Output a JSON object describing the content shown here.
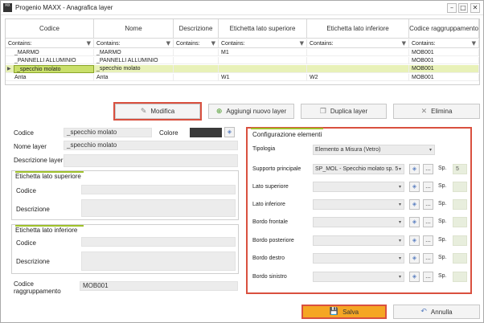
{
  "window": {
    "app_icon": "MX",
    "title": "Progenio MAXX - Anagrafica layer",
    "minimize_glyph": "–",
    "maximize_glyph": "□",
    "close_glyph": "✕"
  },
  "grid": {
    "columns": [
      "Codice",
      "Nome",
      "Descrizione",
      "Etichetta lato superiore",
      "Etichetta lato inferiore",
      "Codice raggruppamento"
    ],
    "filter_label": "Contains:",
    "filter_icon": "▼",
    "row_indicator": "▶",
    "rows": [
      [
        "_MARMO",
        "_MARMO",
        "",
        "M1",
        "",
        "MOB001"
      ],
      [
        "_PANNELLI ALLUMINIO",
        "_PANNELLI ALLUMINIO",
        "",
        "",
        "",
        "MOB001"
      ],
      [
        "_specchio molato",
        "_specchio molato",
        "",
        "",
        "",
        "MOB001"
      ],
      [
        "Anta",
        "Anta",
        "",
        "W1",
        "W2",
        "MOB001"
      ]
    ],
    "selected_row": 2
  },
  "actions": {
    "modifica": "Modifica",
    "aggiungi": "Aggiungi nuovo layer",
    "duplica": "Duplica layer",
    "elimina": "Elimina"
  },
  "icons": {
    "pencil": "✎",
    "plus": "⊕",
    "copy": "❐",
    "x": "✕",
    "save": "💾",
    "undo": "↶"
  },
  "left": {
    "codice_label": "Codice",
    "codice_value": "_specchio molato",
    "colore_label": "Colore",
    "color_swatch": "#3a3a3a",
    "nome_label": "Nome layer",
    "nome_value": "_specchio molato",
    "descr_label": "Descrizione layer",
    "descr_value": "",
    "sup_title": "Etichetta lato superiore",
    "sup_codice": "Codice",
    "sup_descr": "Descrizione",
    "inf_title": "Etichetta lato inferiore",
    "inf_codice": "Codice",
    "inf_descr": "Descrizione",
    "ragg_label": "Codice raggruppamento",
    "ragg_value": "MOB001"
  },
  "config": {
    "title": "Configurazione elementi",
    "tipologia_label": "Tipologia",
    "tipologia_value": "Elemento a Misura (Vetro)",
    "sp_label": "Sp.",
    "more_glyph": "...",
    "eraser_glyph": "◈",
    "supporto": {
      "label": "Supporto principale",
      "value": "SP_MOL - Specchio molato sp. 5",
      "sp": "5"
    },
    "rows": [
      {
        "label": "Lato superiore",
        "value": "",
        "sp": ""
      },
      {
        "label": "Lato inferiore",
        "value": "",
        "sp": ""
      },
      {
        "label": "Bordo frontale",
        "value": "",
        "sp": ""
      },
      {
        "label": "Bordo posteriore",
        "value": "",
        "sp": ""
      },
      {
        "label": "Bordo destro",
        "value": "",
        "sp": ""
      },
      {
        "label": "Bordo sinistro",
        "value": "",
        "sp": ""
      }
    ]
  },
  "footer": {
    "salva": "Salva",
    "annulla": "Annulla"
  },
  "colors": {
    "accent_green": "#9fc12a",
    "selected_row": "#e8f1b8",
    "highlight_red": "#d9503f",
    "save_orange": "#f5a623"
  }
}
